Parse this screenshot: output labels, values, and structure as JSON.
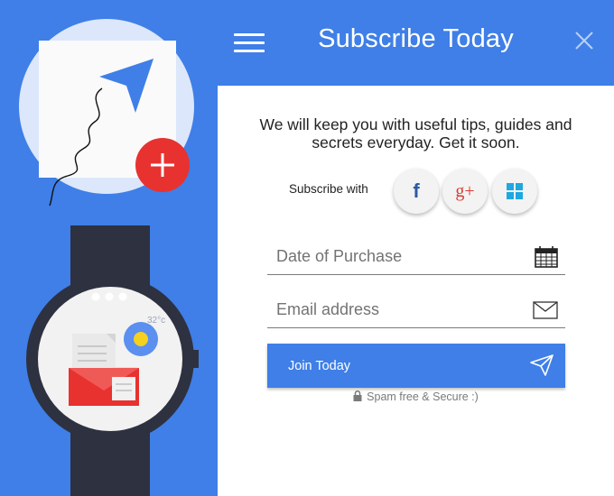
{
  "header": {
    "title": "Subscribe Today",
    "menu_icon": "hamburger-menu-icon",
    "close_icon": "close-icon"
  },
  "intro": {
    "text": "We will keep you with useful tips, guides and secrets everyday. Get it soon."
  },
  "social": {
    "label": "Subscribe with",
    "buttons": [
      {
        "name": "facebook",
        "glyph": "f",
        "icon": "facebook-icon",
        "color": "#2d5aa6"
      },
      {
        "name": "google-plus",
        "glyph": "g+",
        "icon": "google-plus-icon",
        "color": "#d93b30"
      },
      {
        "name": "windows",
        "glyph": "",
        "icon": "windows-icon",
        "color": "#1fa7e0"
      }
    ]
  },
  "form": {
    "date": {
      "placeholder": "Date of Purchase",
      "value": "",
      "icon": "calendar-icon"
    },
    "email": {
      "placeholder": "Email address",
      "value": "",
      "icon": "envelope-icon"
    },
    "submit": {
      "label": "Join Today",
      "icon": "send-icon"
    },
    "note": "Spam free & Secure :)",
    "note_icon": "lock-icon"
  },
  "illustration": {
    "temperature": "32°c"
  },
  "colors": {
    "primary": "#3f7fe7",
    "accent_red": "#e8322f",
    "watch_body": "#2e3140",
    "text": "#222222"
  }
}
